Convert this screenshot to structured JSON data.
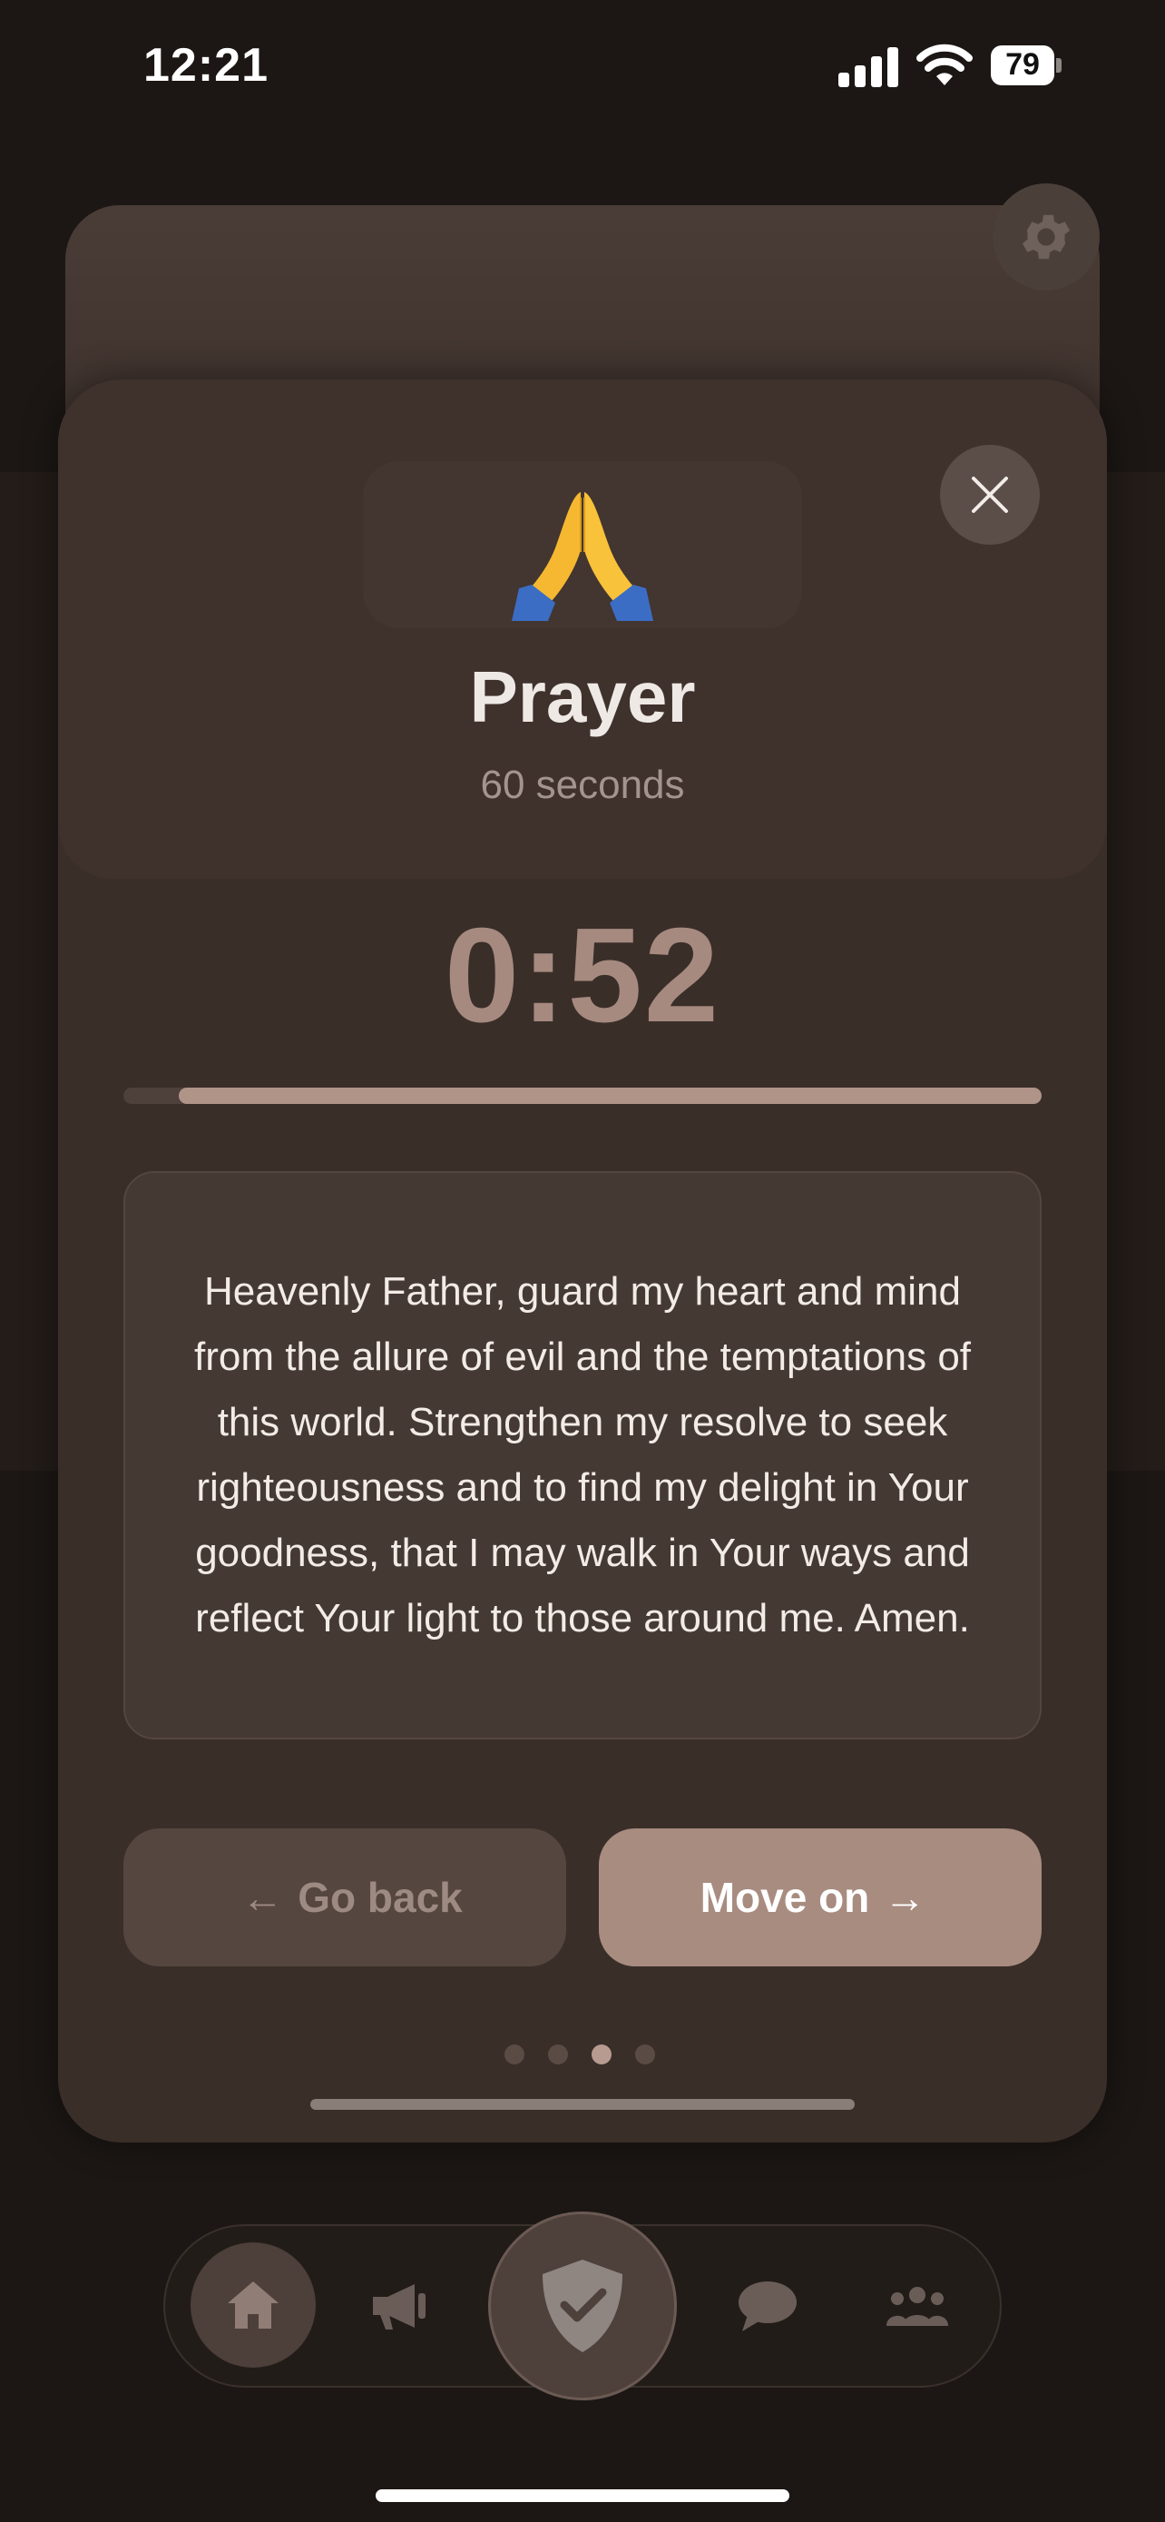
{
  "status_bar": {
    "time": "12:21",
    "battery": "79"
  },
  "card": {
    "emoji": "🙏",
    "title": "Prayer",
    "duration": "60 seconds"
  },
  "timer": {
    "display": "0:52",
    "progress_remaining": 0.94
  },
  "prayer_text": "Heavenly Father, guard my heart and mind from the allure of evil and the temptations of this world. Strengthen my resolve to seek righteousness and to find my delight in Your goodness, that I may walk in Your ways and reflect Your light to those around me. Amen.",
  "buttons": {
    "back": {
      "label": "Go back",
      "arrow": "←"
    },
    "next": {
      "label": "Move on",
      "arrow": "→"
    }
  },
  "pagination": {
    "total": 4,
    "active_index": 2
  },
  "tabbar": {
    "items": [
      {
        "icon": "home-icon",
        "active": true
      },
      {
        "icon": "megaphone-icon",
        "active": false
      },
      {
        "icon": "shield-check-icon",
        "active": false
      },
      {
        "icon": "chat-bubble-icon",
        "active": false
      },
      {
        "icon": "community-icon",
        "active": false
      }
    ]
  },
  "colors": {
    "background": "#1c1714",
    "sheet": "#3a2e29",
    "accent": "#a88c80",
    "timer": "#a68a7f"
  }
}
